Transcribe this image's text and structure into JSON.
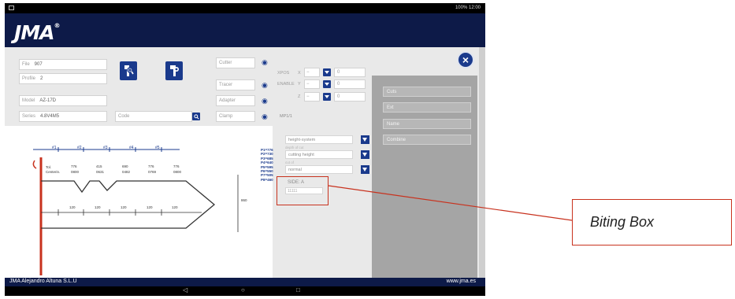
{
  "status_bar": {
    "right_text": "100% 12:00"
  },
  "brand": {
    "logo_text": "JMA",
    "logo_mark": "®"
  },
  "close_button": {
    "label": "×",
    "icon": "close-icon"
  },
  "key_info": {
    "file_label": "File",
    "file_value": "907",
    "profile_label": "Profile",
    "profile_value": "2",
    "model_label": "Model",
    "model_value": "AZ-17D",
    "series_label": "Series",
    "series_value": "4.8V4M5",
    "code_placeholder": "Code"
  },
  "tools": [
    {
      "name": "key-search-icon"
    },
    {
      "name": "key-cut-icon"
    }
  ],
  "machine_options": {
    "cutter_label": "Cutter",
    "tracer_label": "Tracer",
    "adapter_label": "Adapter",
    "clamp_label": "Clamp",
    "mpu_text": "MP1/1"
  },
  "axis_controls": {
    "xpos_label": "XPOS",
    "enable_label": "ENABLE",
    "rows": [
      {
        "axis": "X",
        "value": "0"
      },
      {
        "axis": "Y",
        "value": "0"
      },
      {
        "axis": "Z",
        "value": "0"
      }
    ]
  },
  "right_fields": [
    {
      "placeholder": "Cuts"
    },
    {
      "placeholder": "Ext"
    },
    {
      "placeholder": "Name"
    },
    {
      "placeholder": "Combine"
    }
  ],
  "selects": [
    {
      "value": "height-system"
    },
    {
      "caption": "depth of cut",
      "value": "cutting height"
    },
    {
      "caption": "cut of",
      "value": "normal"
    }
  ],
  "biting_box": {
    "side_label": "SIDE: A",
    "value": "11111"
  },
  "drawing": {
    "pos_labels": [
      "#1",
      "#2",
      "#3",
      "#4",
      "#5"
    ],
    "notes": [
      "P1=776",
      "P2=730",
      "P3=685",
      "P4=640",
      "P5=595",
      "P6=550",
      "P7=505",
      "P8=460"
    ],
    "left_labels": {
      "line1": "Tol.",
      "line2": "Centerin."
    },
    "cut_values": [
      "776",
      "415",
      "690",
      "776",
      "776"
    ],
    "sub_values": [
      "0800",
      "0631",
      "0482",
      "0769",
      "0800"
    ],
    "bottom_labels": [
      "120",
      "120",
      "120",
      "120",
      "120"
    ],
    "dimension": "860"
  },
  "footer": {
    "company": "JMA Alejandro Altuna S.L.U",
    "website": "www.jma.es"
  },
  "navbar": {
    "back": "◁",
    "home": "○",
    "recents": "□"
  },
  "callout": {
    "label": "Biting Box",
    "color": "#c8321e"
  }
}
